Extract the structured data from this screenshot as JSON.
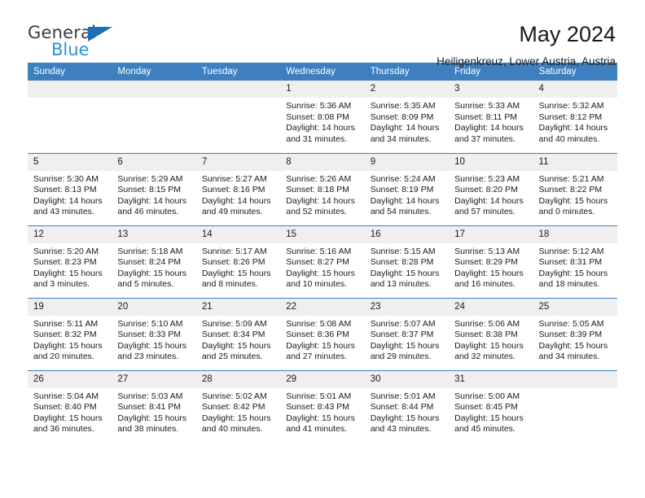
{
  "brand": {
    "name_part1": "General",
    "name_part2": "Blue",
    "accent_blue": "#1c6fb8",
    "light_blue": "#2e91d6"
  },
  "header": {
    "title": "May 2024",
    "subtitle": "Heiligenkreuz, Lower Austria, Austria"
  },
  "calendar": {
    "header_bg": "#3d7fbf",
    "daynum_bg": "#efefef",
    "weekdays": [
      "Sunday",
      "Monday",
      "Tuesday",
      "Wednesday",
      "Thursday",
      "Friday",
      "Saturday"
    ],
    "weeks": [
      [
        {
          "day": "",
          "empty": true
        },
        {
          "day": "",
          "empty": true
        },
        {
          "day": "",
          "empty": true
        },
        {
          "day": "1",
          "sunrise": "Sunrise: 5:36 AM",
          "sunset": "Sunset: 8:08 PM",
          "daylight_line1": "Daylight: 14 hours",
          "daylight_line2": "and 31 minutes."
        },
        {
          "day": "2",
          "sunrise": "Sunrise: 5:35 AM",
          "sunset": "Sunset: 8:09 PM",
          "daylight_line1": "Daylight: 14 hours",
          "daylight_line2": "and 34 minutes."
        },
        {
          "day": "3",
          "sunrise": "Sunrise: 5:33 AM",
          "sunset": "Sunset: 8:11 PM",
          "daylight_line1": "Daylight: 14 hours",
          "daylight_line2": "and 37 minutes."
        },
        {
          "day": "4",
          "sunrise": "Sunrise: 5:32 AM",
          "sunset": "Sunset: 8:12 PM",
          "daylight_line1": "Daylight: 14 hours",
          "daylight_line2": "and 40 minutes."
        }
      ],
      [
        {
          "day": "5",
          "sunrise": "Sunrise: 5:30 AM",
          "sunset": "Sunset: 8:13 PM",
          "daylight_line1": "Daylight: 14 hours",
          "daylight_line2": "and 43 minutes."
        },
        {
          "day": "6",
          "sunrise": "Sunrise: 5:29 AM",
          "sunset": "Sunset: 8:15 PM",
          "daylight_line1": "Daylight: 14 hours",
          "daylight_line2": "and 46 minutes."
        },
        {
          "day": "7",
          "sunrise": "Sunrise: 5:27 AM",
          "sunset": "Sunset: 8:16 PM",
          "daylight_line1": "Daylight: 14 hours",
          "daylight_line2": "and 49 minutes."
        },
        {
          "day": "8",
          "sunrise": "Sunrise: 5:26 AM",
          "sunset": "Sunset: 8:18 PM",
          "daylight_line1": "Daylight: 14 hours",
          "daylight_line2": "and 52 minutes."
        },
        {
          "day": "9",
          "sunrise": "Sunrise: 5:24 AM",
          "sunset": "Sunset: 8:19 PM",
          "daylight_line1": "Daylight: 14 hours",
          "daylight_line2": "and 54 minutes."
        },
        {
          "day": "10",
          "sunrise": "Sunrise: 5:23 AM",
          "sunset": "Sunset: 8:20 PM",
          "daylight_line1": "Daylight: 14 hours",
          "daylight_line2": "and 57 minutes."
        },
        {
          "day": "11",
          "sunrise": "Sunrise: 5:21 AM",
          "sunset": "Sunset: 8:22 PM",
          "daylight_line1": "Daylight: 15 hours",
          "daylight_line2": "and 0 minutes."
        }
      ],
      [
        {
          "day": "12",
          "sunrise": "Sunrise: 5:20 AM",
          "sunset": "Sunset: 8:23 PM",
          "daylight_line1": "Daylight: 15 hours",
          "daylight_line2": "and 3 minutes."
        },
        {
          "day": "13",
          "sunrise": "Sunrise: 5:18 AM",
          "sunset": "Sunset: 8:24 PM",
          "daylight_line1": "Daylight: 15 hours",
          "daylight_line2": "and 5 minutes."
        },
        {
          "day": "14",
          "sunrise": "Sunrise: 5:17 AM",
          "sunset": "Sunset: 8:26 PM",
          "daylight_line1": "Daylight: 15 hours",
          "daylight_line2": "and 8 minutes."
        },
        {
          "day": "15",
          "sunrise": "Sunrise: 5:16 AM",
          "sunset": "Sunset: 8:27 PM",
          "daylight_line1": "Daylight: 15 hours",
          "daylight_line2": "and 10 minutes."
        },
        {
          "day": "16",
          "sunrise": "Sunrise: 5:15 AM",
          "sunset": "Sunset: 8:28 PM",
          "daylight_line1": "Daylight: 15 hours",
          "daylight_line2": "and 13 minutes."
        },
        {
          "day": "17",
          "sunrise": "Sunrise: 5:13 AM",
          "sunset": "Sunset: 8:29 PM",
          "daylight_line1": "Daylight: 15 hours",
          "daylight_line2": "and 16 minutes."
        },
        {
          "day": "18",
          "sunrise": "Sunrise: 5:12 AM",
          "sunset": "Sunset: 8:31 PM",
          "daylight_line1": "Daylight: 15 hours",
          "daylight_line2": "and 18 minutes."
        }
      ],
      [
        {
          "day": "19",
          "sunrise": "Sunrise: 5:11 AM",
          "sunset": "Sunset: 8:32 PM",
          "daylight_line1": "Daylight: 15 hours",
          "daylight_line2": "and 20 minutes."
        },
        {
          "day": "20",
          "sunrise": "Sunrise: 5:10 AM",
          "sunset": "Sunset: 8:33 PM",
          "daylight_line1": "Daylight: 15 hours",
          "daylight_line2": "and 23 minutes."
        },
        {
          "day": "21",
          "sunrise": "Sunrise: 5:09 AM",
          "sunset": "Sunset: 8:34 PM",
          "daylight_line1": "Daylight: 15 hours",
          "daylight_line2": "and 25 minutes."
        },
        {
          "day": "22",
          "sunrise": "Sunrise: 5:08 AM",
          "sunset": "Sunset: 8:36 PM",
          "daylight_line1": "Daylight: 15 hours",
          "daylight_line2": "and 27 minutes."
        },
        {
          "day": "23",
          "sunrise": "Sunrise: 5:07 AM",
          "sunset": "Sunset: 8:37 PM",
          "daylight_line1": "Daylight: 15 hours",
          "daylight_line2": "and 29 minutes."
        },
        {
          "day": "24",
          "sunrise": "Sunrise: 5:06 AM",
          "sunset": "Sunset: 8:38 PM",
          "daylight_line1": "Daylight: 15 hours",
          "daylight_line2": "and 32 minutes."
        },
        {
          "day": "25",
          "sunrise": "Sunrise: 5:05 AM",
          "sunset": "Sunset: 8:39 PM",
          "daylight_line1": "Daylight: 15 hours",
          "daylight_line2": "and 34 minutes."
        }
      ],
      [
        {
          "day": "26",
          "sunrise": "Sunrise: 5:04 AM",
          "sunset": "Sunset: 8:40 PM",
          "daylight_line1": "Daylight: 15 hours",
          "daylight_line2": "and 36 minutes."
        },
        {
          "day": "27",
          "sunrise": "Sunrise: 5:03 AM",
          "sunset": "Sunset: 8:41 PM",
          "daylight_line1": "Daylight: 15 hours",
          "daylight_line2": "and 38 minutes."
        },
        {
          "day": "28",
          "sunrise": "Sunrise: 5:02 AM",
          "sunset": "Sunset: 8:42 PM",
          "daylight_line1": "Daylight: 15 hours",
          "daylight_line2": "and 40 minutes."
        },
        {
          "day": "29",
          "sunrise": "Sunrise: 5:01 AM",
          "sunset": "Sunset: 8:43 PM",
          "daylight_line1": "Daylight: 15 hours",
          "daylight_line2": "and 41 minutes."
        },
        {
          "day": "30",
          "sunrise": "Sunrise: 5:01 AM",
          "sunset": "Sunset: 8:44 PM",
          "daylight_line1": "Daylight: 15 hours",
          "daylight_line2": "and 43 minutes."
        },
        {
          "day": "31",
          "sunrise": "Sunrise: 5:00 AM",
          "sunset": "Sunset: 8:45 PM",
          "daylight_line1": "Daylight: 15 hours",
          "daylight_line2": "and 45 minutes."
        },
        {
          "day": "",
          "empty": true
        }
      ]
    ]
  }
}
